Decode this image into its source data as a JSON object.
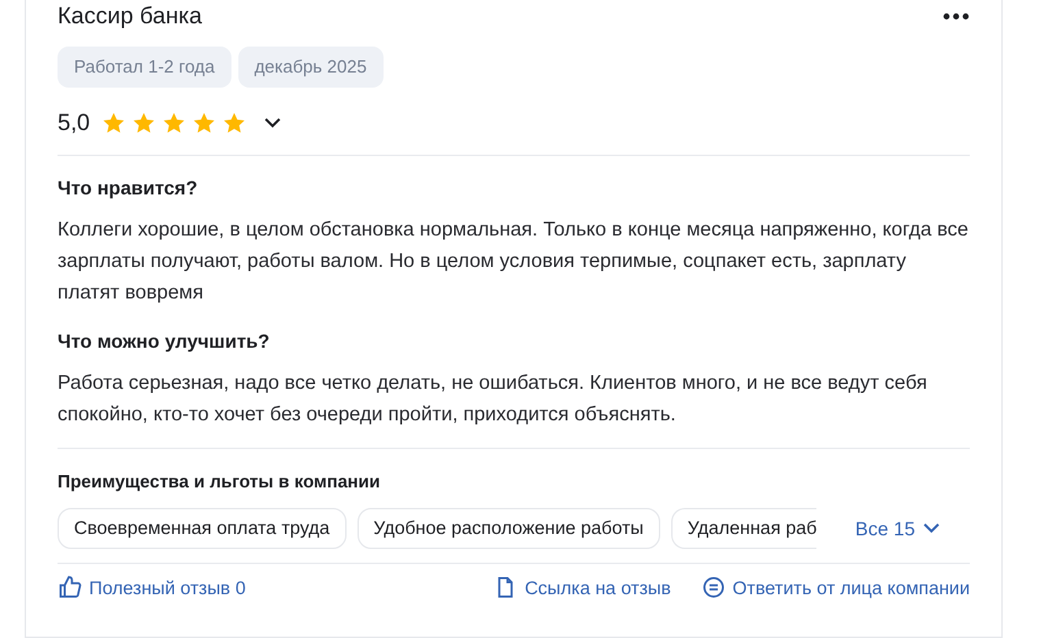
{
  "review": {
    "title": "Кассир банка",
    "tags": [
      "Работал 1-2 года",
      "декабрь 2025"
    ],
    "rating": {
      "value": "5,0",
      "stars": 5
    },
    "sections": [
      {
        "heading": "Что нравится?",
        "text": "Коллеги хорошие, в целом обстановка нормальная. Только в конце месяца напряженно, когда все зарплаты получают, работы валом. Но в целом условия терпимые, соцпакет есть, зарплату платят вовремя"
      },
      {
        "heading": "Что можно улучшить?",
        "text": "Работа серьезная, надо все четко делать, не ошибаться. Клиентов много, и не все ведут себя спокойно, кто-то хочет без очереди пройти, приходится объяснять."
      }
    ],
    "benefits": {
      "heading": "Преимущества и льготы в компании",
      "chips": [
        "Своевременная оплата труда",
        "Удобное расположение работы",
        "Удаленная раб"
      ],
      "more": "Все 15"
    },
    "actions": [
      {
        "kind": "like",
        "label": "Полезный отзыв 0"
      },
      {
        "kind": "share",
        "label": "Ссылка на отзыв"
      },
      {
        "kind": "reply",
        "label": "Ответить от лица компании"
      }
    ]
  }
}
